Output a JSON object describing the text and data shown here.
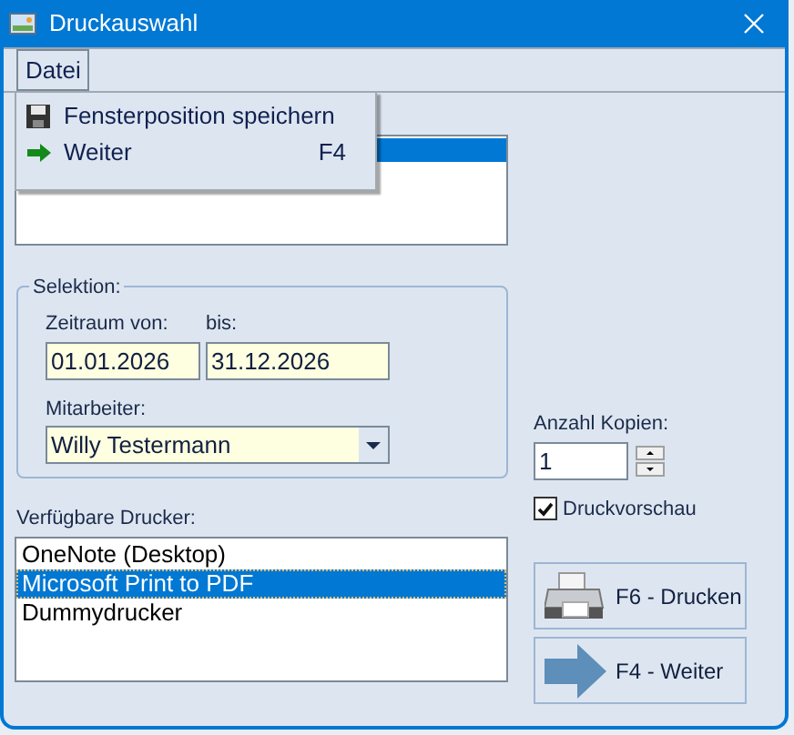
{
  "window": {
    "title": "Druckauswahl"
  },
  "menu_bar": [
    {
      "label": "Datei",
      "expanded": true
    }
  ],
  "menu_items": [
    {
      "kind": "save",
      "label": "Fensterposition speichern"
    },
    {
      "kind": "next",
      "label": "Weiter",
      "shortcut": "F4"
    }
  ],
  "selection": {
    "title": "Selektion:",
    "from_label": "Zeitraum von:",
    "from_value": "01.01.2026",
    "to_label": "bis:",
    "to_value": "31.12.2026",
    "employee_label": "Mitarbeiter:",
    "employee_value": "Willy Testermann"
  },
  "copies": {
    "label": "Anzahl Kopien:",
    "value": "1"
  },
  "preview": {
    "label": "Druckvorschau",
    "checked": true
  },
  "printers": {
    "label": "Verfügbare Drucker:",
    "items": [
      {
        "label": "OneNote (Desktop)",
        "selected": false
      },
      {
        "label": "Microsoft Print to PDF",
        "selected": true
      },
      {
        "label": "Dummydrucker",
        "selected": false
      }
    ]
  },
  "buttons": [
    {
      "kind": "print",
      "label": "F6 - Drucken"
    },
    {
      "kind": "next",
      "label": "F4 - Weiter"
    }
  ]
}
